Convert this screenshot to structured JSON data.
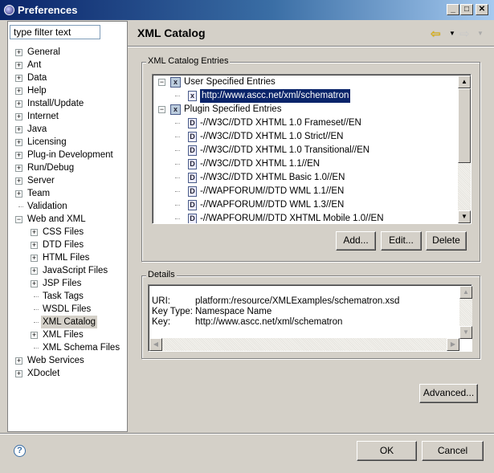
{
  "window": {
    "title": "Preferences",
    "min": "_",
    "max": "□",
    "close": "✕"
  },
  "filter": {
    "placeholder": "type filter text",
    "value": "type filter text"
  },
  "nav_tree": [
    {
      "label": "General",
      "level": 0,
      "expander": "+"
    },
    {
      "label": "Ant",
      "level": 0,
      "expander": "+"
    },
    {
      "label": "Data",
      "level": 0,
      "expander": "+"
    },
    {
      "label": "Help",
      "level": 0,
      "expander": "+"
    },
    {
      "label": "Install/Update",
      "level": 0,
      "expander": "+"
    },
    {
      "label": "Internet",
      "level": 0,
      "expander": "+"
    },
    {
      "label": "Java",
      "level": 0,
      "expander": "+"
    },
    {
      "label": "Licensing",
      "level": 0,
      "expander": "+"
    },
    {
      "label": "Plug-in Development",
      "level": 0,
      "expander": "+"
    },
    {
      "label": "Run/Debug",
      "level": 0,
      "expander": "+"
    },
    {
      "label": "Server",
      "level": 0,
      "expander": "+"
    },
    {
      "label": "Team",
      "level": 0,
      "expander": "+"
    },
    {
      "label": "Validation",
      "level": 0,
      "expander": ""
    },
    {
      "label": "Web and XML",
      "level": 0,
      "expander": "-"
    },
    {
      "label": "CSS Files",
      "level": 1,
      "expander": "+"
    },
    {
      "label": "DTD Files",
      "level": 1,
      "expander": "+"
    },
    {
      "label": "HTML Files",
      "level": 1,
      "expander": "+"
    },
    {
      "label": "JavaScript Files",
      "level": 1,
      "expander": "+"
    },
    {
      "label": "JSP Files",
      "level": 1,
      "expander": "+"
    },
    {
      "label": "Task Tags",
      "level": 1,
      "expander": ""
    },
    {
      "label": "WSDL Files",
      "level": 1,
      "expander": ""
    },
    {
      "label": "XML Catalog",
      "level": 1,
      "expander": "",
      "selected": true
    },
    {
      "label": "XML Files",
      "level": 1,
      "expander": "+"
    },
    {
      "label": "XML Schema Files",
      "level": 1,
      "expander": ""
    },
    {
      "label": "Web Services",
      "level": 0,
      "expander": "+"
    },
    {
      "label": "XDoclet",
      "level": 0,
      "expander": "+"
    }
  ],
  "page": {
    "title": "XML Catalog",
    "back_icon": "back-arrow-icon",
    "forward_icon": "forward-arrow-icon"
  },
  "catalog": {
    "group_label": "XML Catalog Entries",
    "entries": [
      {
        "label": "User Specified Entries",
        "level": 0,
        "icon": "catalog-icon",
        "expander": "-"
      },
      {
        "label": "http://www.ascc.net/xml/schematron",
        "level": 1,
        "icon": "x",
        "selected": true
      },
      {
        "label": "Plugin Specified Entries",
        "level": 0,
        "icon": "catalog-icon",
        "expander": "-"
      },
      {
        "label": "-//W3C//DTD XHTML 1.0 Frameset//EN",
        "level": 1,
        "icon": "D"
      },
      {
        "label": "-//W3C//DTD XHTML 1.0 Strict//EN",
        "level": 1,
        "icon": "D"
      },
      {
        "label": "-//W3C//DTD XHTML 1.0 Transitional//EN",
        "level": 1,
        "icon": "D"
      },
      {
        "label": "-//W3C//DTD XHTML 1.1//EN",
        "level": 1,
        "icon": "D"
      },
      {
        "label": "-//W3C//DTD XHTML Basic 1.0//EN",
        "level": 1,
        "icon": "D"
      },
      {
        "label": "-//WAPFORUM//DTD WML 1.1//EN",
        "level": 1,
        "icon": "D"
      },
      {
        "label": "-//WAPFORUM//DTD WML 1.3//EN",
        "level": 1,
        "icon": "D"
      },
      {
        "label": "-//WAPFORUM//DTD XHTML Mobile 1.0//EN",
        "level": 1,
        "icon": "D"
      }
    ],
    "buttons": {
      "add": "Add...",
      "edit": "Edit...",
      "delete": "Delete"
    }
  },
  "details": {
    "group_label": "Details",
    "rows": [
      {
        "key": "URI:",
        "value": "platform:/resource/XMLExamples/schematron.xsd"
      },
      {
        "key": "Key Type:",
        "value": "Namespace Name"
      },
      {
        "key": "Key:",
        "value": "http://www.ascc.net/xml/schematron"
      }
    ]
  },
  "advanced": "Advanced...",
  "footer": {
    "help": "?",
    "ok": "OK",
    "cancel": "Cancel"
  }
}
